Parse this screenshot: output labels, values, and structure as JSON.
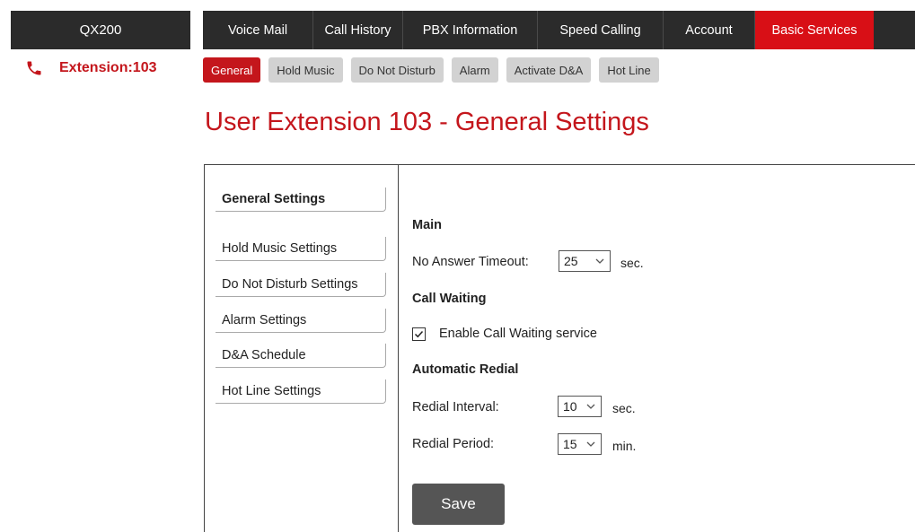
{
  "brand": "QX200",
  "main_nav": [
    {
      "label": "Voice Mail",
      "active": false
    },
    {
      "label": "Call History",
      "active": false
    },
    {
      "label": "PBX Information",
      "active": false
    },
    {
      "label": "Speed Calling",
      "active": false
    },
    {
      "label": "Account",
      "active": false
    },
    {
      "label": "Basic Services",
      "active": true
    }
  ],
  "extension": {
    "label": "Extension:103",
    "icon": "phone-icon"
  },
  "sub_nav": [
    {
      "label": "General",
      "active": true
    },
    {
      "label": "Hold Music",
      "active": false
    },
    {
      "label": "Do Not Disturb",
      "active": false
    },
    {
      "label": "Alarm",
      "active": false
    },
    {
      "label": "Activate D&A",
      "active": false
    },
    {
      "label": "Hot Line",
      "active": false
    }
  ],
  "page_title": "User Extension 103 - General Settings",
  "side_menu": [
    {
      "label": "General Settings",
      "active": true
    },
    {
      "label": "Hold Music Settings",
      "active": false
    },
    {
      "label": "Do Not Disturb Settings",
      "active": false
    },
    {
      "label": "Alarm Settings",
      "active": false
    },
    {
      "label": "D&A Schedule",
      "active": false
    },
    {
      "label": "Hot Line Settings",
      "active": false
    }
  ],
  "form": {
    "main": {
      "heading": "Main",
      "no_answer_label": "No Answer Timeout:",
      "no_answer_value": "25",
      "no_answer_unit": "sec."
    },
    "call_waiting": {
      "heading": "Call Waiting",
      "enable_label": "Enable Call Waiting service",
      "enabled": true
    },
    "auto_redial": {
      "heading": "Automatic Redial",
      "interval_label": "Redial Interval:",
      "interval_value": "10",
      "interval_unit": "sec.",
      "period_label": "Redial Period:",
      "period_value": "15",
      "period_unit": "min."
    }
  },
  "save_label": "Save",
  "colors": {
    "accent": "#c4161c",
    "active_tab": "#d80f16",
    "nav_bg": "#2b2b2b",
    "pill_bg": "#d2d2d2",
    "button_bg": "#555555"
  }
}
